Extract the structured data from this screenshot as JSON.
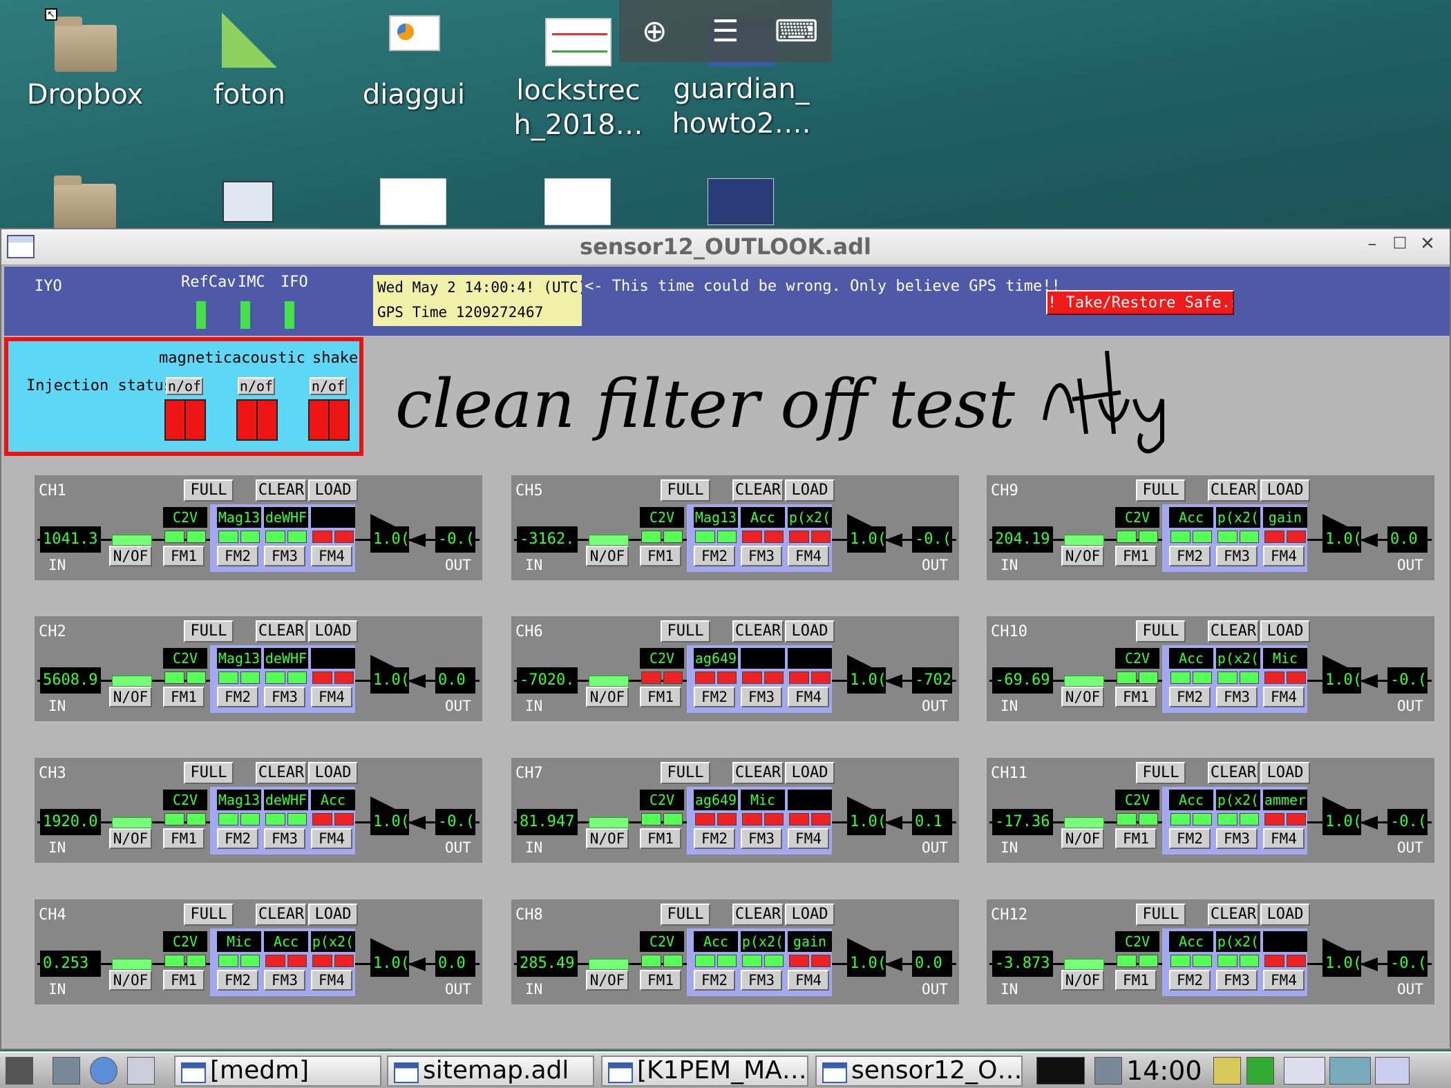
{
  "desktop": {
    "icons": [
      {
        "label": "Dropbox",
        "type": "folder"
      },
      {
        "label": "foton",
        "type": "app"
      },
      {
        "label": "diaggui",
        "type": "app"
      },
      {
        "label": "lockstrec h_2018…",
        "type": "image"
      },
      {
        "label": "guardian_ howto2….",
        "type": "image"
      }
    ]
  },
  "window": {
    "title": "sensor12_OUTLOOK.adl"
  },
  "header": {
    "site": "IYO",
    "refcav": "RefCav",
    "imc": "IMC",
    "ifo": "IFO",
    "time_line1": "Wed May  2 14:00:4! (UTC)",
    "time_line2": "GPS Time 1209272467",
    "warning": "<- This time could be wrong. Only believe GPS time!!",
    "safe_button": "! Take/Restore Safe.s"
  },
  "injection": {
    "label": "Injection status",
    "magnetic": "magnetic",
    "acoustic": "acoustic",
    "shake": "shake",
    "nof": "n/of"
  },
  "handwritten_note": "clean filter off test",
  "common": {
    "full": "FULL",
    "clear": "CLEAR",
    "load": "LOAD",
    "in": "IN",
    "out": "OUT",
    "nof": "N/OF",
    "fm1": "FM1",
    "fm2": "FM2",
    "fm3": "FM3",
    "fm4": "FM4",
    "gain": "1.0("
  },
  "channels": [
    {
      "name": "CH1",
      "in": "1041.3",
      "out": "-0.(",
      "f": [
        [
          "C2V",
          1
        ],
        [
          "Mag13",
          1
        ],
        [
          "deWHF",
          1
        ],
        [
          "",
          0
        ]
      ]
    },
    {
      "name": "CH2",
      "in": "5608.9",
      "out": "0.0",
      "f": [
        [
          "C2V",
          1
        ],
        [
          "Mag13",
          1
        ],
        [
          "deWHF",
          1
        ],
        [
          "",
          0
        ]
      ]
    },
    {
      "name": "CH3",
      "in": "1920.0",
      "out": "-0.(",
      "f": [
        [
          "C2V",
          1
        ],
        [
          "Mag13",
          1
        ],
        [
          "deWHF",
          1
        ],
        [
          "Acc",
          0
        ]
      ]
    },
    {
      "name": "CH4",
      "in": "0.253",
      "out": "0.0",
      "f": [
        [
          "C2V",
          1
        ],
        [
          "Mic",
          1
        ],
        [
          "Acc",
          0
        ],
        [
          "p(x2(",
          0
        ]
      ]
    },
    {
      "name": "CH5",
      "in": "-3162.",
      "out": "-0.(",
      "f": [
        [
          "C2V",
          1
        ],
        [
          "Mag13",
          1
        ],
        [
          "Acc",
          0
        ],
        [
          "p(x2(",
          0
        ]
      ]
    },
    {
      "name": "CH6",
      "in": "-7020.",
      "out": "-702",
      "f": [
        [
          "C2V",
          0
        ],
        [
          "ag649",
          0
        ],
        [
          "",
          0
        ],
        [
          "",
          0
        ]
      ]
    },
    {
      "name": "CH7",
      "in": "81.947",
      "out": "0.1",
      "f": [
        [
          "C2V",
          1
        ],
        [
          "ag649",
          0
        ],
        [
          "Mic",
          0
        ],
        [
          "",
          0
        ]
      ]
    },
    {
      "name": "CH8",
      "in": "285.49",
      "out": "0.0",
      "f": [
        [
          "C2V",
          1
        ],
        [
          "Acc",
          1
        ],
        [
          "p(x2(",
          1
        ],
        [
          "gain",
          0
        ]
      ]
    },
    {
      "name": "CH9",
      "in": "204.19",
      "out": "0.0",
      "f": [
        [
          "C2V",
          1
        ],
        [
          "Acc",
          1
        ],
        [
          "p(x2(",
          1
        ],
        [
          "gain",
          0
        ]
      ]
    },
    {
      "name": "CH10",
      "in": "-69.69",
      "out": "-0.(",
      "f": [
        [
          "C2V",
          1
        ],
        [
          "Acc",
          1
        ],
        [
          "p(x2(",
          1
        ],
        [
          "Mic",
          0
        ]
      ]
    },
    {
      "name": "CH11",
      "in": "-17.36",
      "out": "-0.(",
      "f": [
        [
          "C2V",
          1
        ],
        [
          "Acc",
          1
        ],
        [
          "p(x2(",
          1
        ],
        [
          "ammer",
          0
        ]
      ]
    },
    {
      "name": "CH12",
      "in": "-3.873",
      "out": "-0.(",
      "f": [
        [
          "C2V",
          1
        ],
        [
          "Acc",
          1
        ],
        [
          "p(x2(",
          1
        ],
        [
          "",
          0
        ]
      ]
    }
  ],
  "taskbar": {
    "items": [
      "[medm]",
      "sitemap.adl",
      "[K1PEM_MA…",
      "sensor12_O…"
    ],
    "clock": "14:00"
  }
}
